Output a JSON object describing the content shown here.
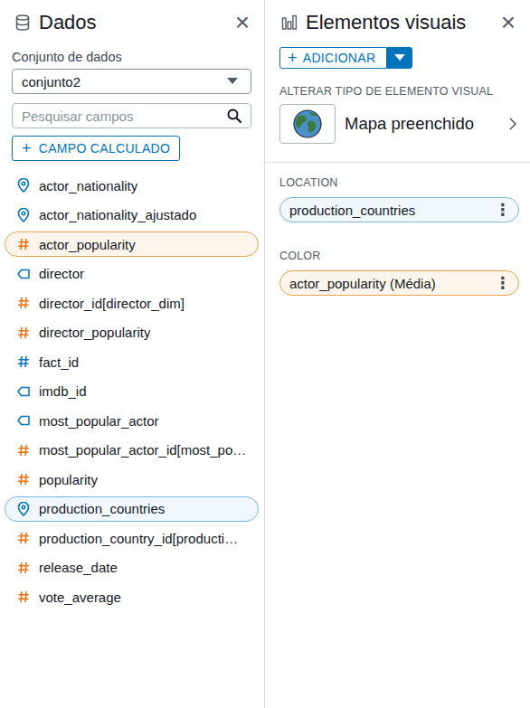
{
  "data_panel": {
    "title": "Dados",
    "close": "×",
    "dataset_label": "Conjunto de dados",
    "dataset": "conjunto2",
    "search_placeholder": "Pesquisar campos",
    "calc_button": {
      "icon": "+",
      "label": "CAMPO CALCULADO"
    },
    "fields": [
      {
        "name": "actor_nationality",
        "kind": "geo",
        "selected": false
      },
      {
        "name": "actor_nationality_ajustado",
        "kind": "geo",
        "selected": false
      },
      {
        "name": "actor_popularity",
        "kind": "measure",
        "selected": true
      },
      {
        "name": "director",
        "kind": "text",
        "selected": false
      },
      {
        "name": "director_id[director_dim]",
        "kind": "measure",
        "selected": false
      },
      {
        "name": "director_popularity",
        "kind": "measure",
        "selected": false
      },
      {
        "name": "fact_id",
        "kind": "number",
        "selected": false
      },
      {
        "name": "imdb_id",
        "kind": "text",
        "selected": false
      },
      {
        "name": "most_popular_actor",
        "kind": "text",
        "selected": false
      },
      {
        "name": "most_popular_actor_id[most_po…",
        "kind": "measure",
        "selected": false
      },
      {
        "name": "popularity",
        "kind": "measure",
        "selected": false
      },
      {
        "name": "production_countries",
        "kind": "geo",
        "selected": true
      },
      {
        "name": "production_country_id[producti…",
        "kind": "measure",
        "selected": false
      },
      {
        "name": "release_date",
        "kind": "measure",
        "selected": false
      },
      {
        "name": "vote_average",
        "kind": "measure",
        "selected": false
      }
    ]
  },
  "visuals_panel": {
    "title": "Elementos visuais",
    "close": "×",
    "add_button": {
      "icon": "+",
      "label": "ADICIONAR"
    },
    "change_type_label": "ALTERAR TIPO DE ELEMENTO VISUAL",
    "visual_type": "Mapa preenchido",
    "wells": [
      {
        "label": "LOCATION",
        "field": "production_countries",
        "kind": "dimension",
        "menu": "⋮"
      },
      {
        "label": "COLOR",
        "field": "actor_popularity (Média)",
        "kind": "measure",
        "menu": "⋮"
      }
    ]
  }
}
